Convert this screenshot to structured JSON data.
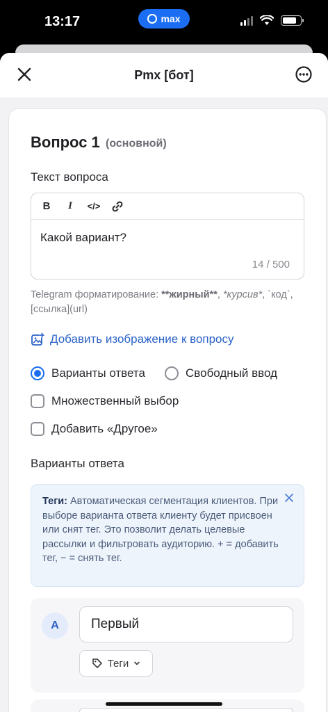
{
  "status_bar": {
    "time": "13:17",
    "app_pill": "max",
    "icons": [
      "signal-icon",
      "wifi-icon",
      "battery-icon"
    ]
  },
  "header": {
    "title": "Pmx [бот]",
    "close_icon": "close-icon",
    "more_icon": "more-icon"
  },
  "question": {
    "title": "Вопрос 1",
    "subtitle": "(основной)",
    "text_label": "Текст вопроса",
    "toolbar": {
      "bold": "B",
      "italic": "I",
      "code": "</>",
      "link_icon": "link-icon"
    },
    "value": "Какой вариант?",
    "counter": "14 / 500",
    "hint_prefix": "Telegram форматирование: ",
    "hint_bold": "**жирный**",
    "hint_sep1": ", ",
    "hint_italic": "*курсив*",
    "hint_rest": ", `код`, [ссылка](url)",
    "add_image_label": "Добавить изображение к вопросу"
  },
  "mode": {
    "options_label": "Варианты ответа",
    "free_label": "Свободный ввод",
    "selected": "options"
  },
  "checkboxes": {
    "multiple": "Множественный выбор",
    "other": "Добавить «Другое»"
  },
  "answers_section": {
    "heading": "Варианты ответа",
    "tags_info_title": "Теги:",
    "tags_info_text": "Автоматическая сегментация клиентов. При выборе варианта ответа клиенту будет присвоен или снят тег. Это позволит делать целевые рассылки и фильтровать аудиторию. + = добавить тег, − = снять тег.",
    "items": [
      {
        "letter": "A",
        "value": "Первый",
        "tags_label": "Теги"
      }
    ]
  },
  "colors": {
    "accent": "#1b6ef3",
    "link": "#2b63c8",
    "info_bg": "#eef4fc"
  }
}
